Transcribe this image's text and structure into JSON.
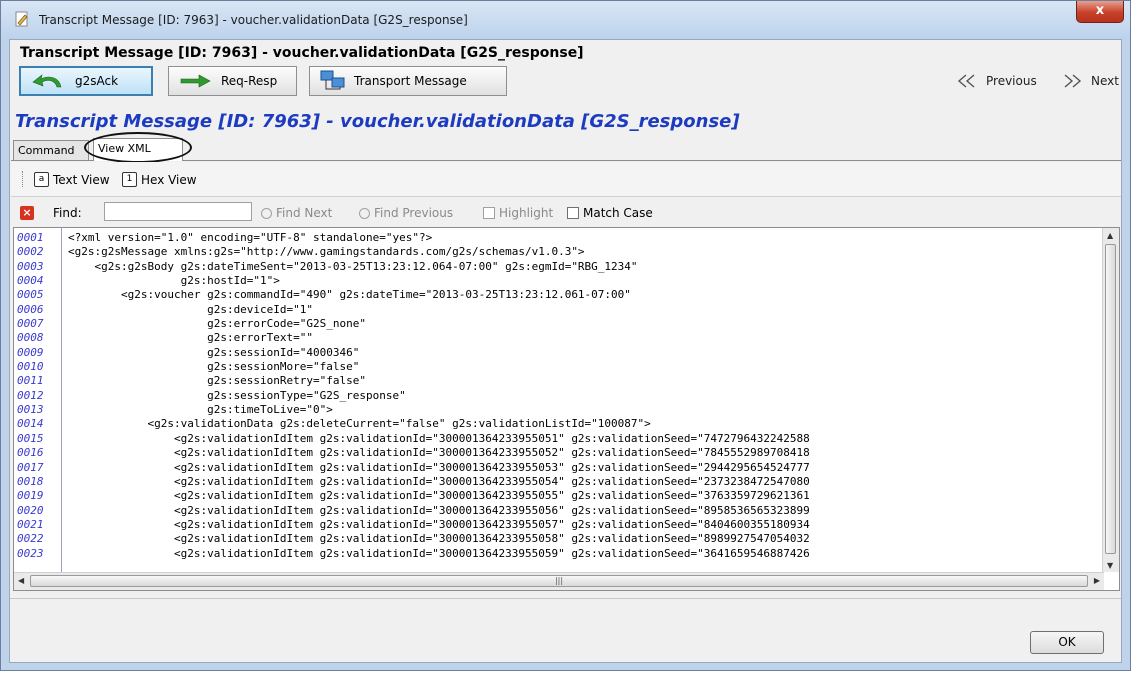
{
  "window": {
    "title": "Transcript Message [ID: 7963] - voucher.validationData [G2S_response]",
    "close_label": "x"
  },
  "header": {
    "title": "Transcript Message [ID: 7963] - voucher.validationData [G2S_response]"
  },
  "toolbar": {
    "g2sack_label": "g2sAck",
    "reqresp_label": "Req-Resp",
    "transport_label": "Transport Message",
    "previous_label": "Previous",
    "next_label": "Next"
  },
  "main": {
    "title": "Transcript Message [ID: 7963] - voucher.validationData [G2S_response]"
  },
  "tabs": [
    {
      "label": "Command"
    },
    {
      "label": "View XML"
    }
  ],
  "view_modes": {
    "text_label": "Text View",
    "hex_label": "Hex View"
  },
  "find": {
    "label": "Find:",
    "value": "",
    "next_label": "Find Next",
    "previous_label": "Find Previous",
    "highlight_label": "Highlight",
    "match_case_label": "Match Case"
  },
  "editor": {
    "line_numbers": "0001\n0002\n0003\n0004\n0005\n0006\n0007\n0008\n0009\n0010\n0011\n0012\n0013\n0014\n0015\n0016\n0017\n0018\n0019\n0020\n0021\n0022\n0023",
    "code": "<?xml version=\"1.0\" encoding=\"UTF-8\" standalone=\"yes\"?>\n<g2s:g2sMessage xmlns:g2s=\"http://www.gamingstandards.com/g2s/schemas/v1.0.3\">\n    <g2s:g2sBody g2s:dateTimeSent=\"2013-03-25T13:23:12.064-07:00\" g2s:egmId=\"RBG_1234\"\n                 g2s:hostId=\"1\">\n        <g2s:voucher g2s:commandId=\"490\" g2s:dateTime=\"2013-03-25T13:23:12.061-07:00\"\n                     g2s:deviceId=\"1\"\n                     g2s:errorCode=\"G2S_none\"\n                     g2s:errorText=\"\"\n                     g2s:sessionId=\"4000346\"\n                     g2s:sessionMore=\"false\"\n                     g2s:sessionRetry=\"false\"\n                     g2s:sessionType=\"G2S_response\"\n                     g2s:timeToLive=\"0\">\n            <g2s:validationData g2s:deleteCurrent=\"false\" g2s:validationListId=\"100087\">\n                <g2s:validationIdItem g2s:validationId=\"300001364233955051\" g2s:validationSeed=\"7472796432242588\n                <g2s:validationIdItem g2s:validationId=\"300001364233955052\" g2s:validationSeed=\"7845552989708418\n                <g2s:validationIdItem g2s:validationId=\"300001364233955053\" g2s:validationSeed=\"2944295654524777\n                <g2s:validationIdItem g2s:validationId=\"300001364233955054\" g2s:validationSeed=\"2373238472547080\n                <g2s:validationIdItem g2s:validationId=\"300001364233955055\" g2s:validationSeed=\"3763359729621361\n                <g2s:validationIdItem g2s:validationId=\"300001364233955056\" g2s:validationSeed=\"8958536565323899\n                <g2s:validationIdItem g2s:validationId=\"300001364233955057\" g2s:validationSeed=\"8404600355180934\n                <g2s:validationIdItem g2s:validationId=\"300001364233955058\" g2s:validationSeed=\"8989927547054032\n                <g2s:validationIdItem g2s:validationId=\"300001364233955059\" g2s:validationSeed=\"3641659546887426"
  },
  "footer": {
    "ok_label": "OK"
  }
}
